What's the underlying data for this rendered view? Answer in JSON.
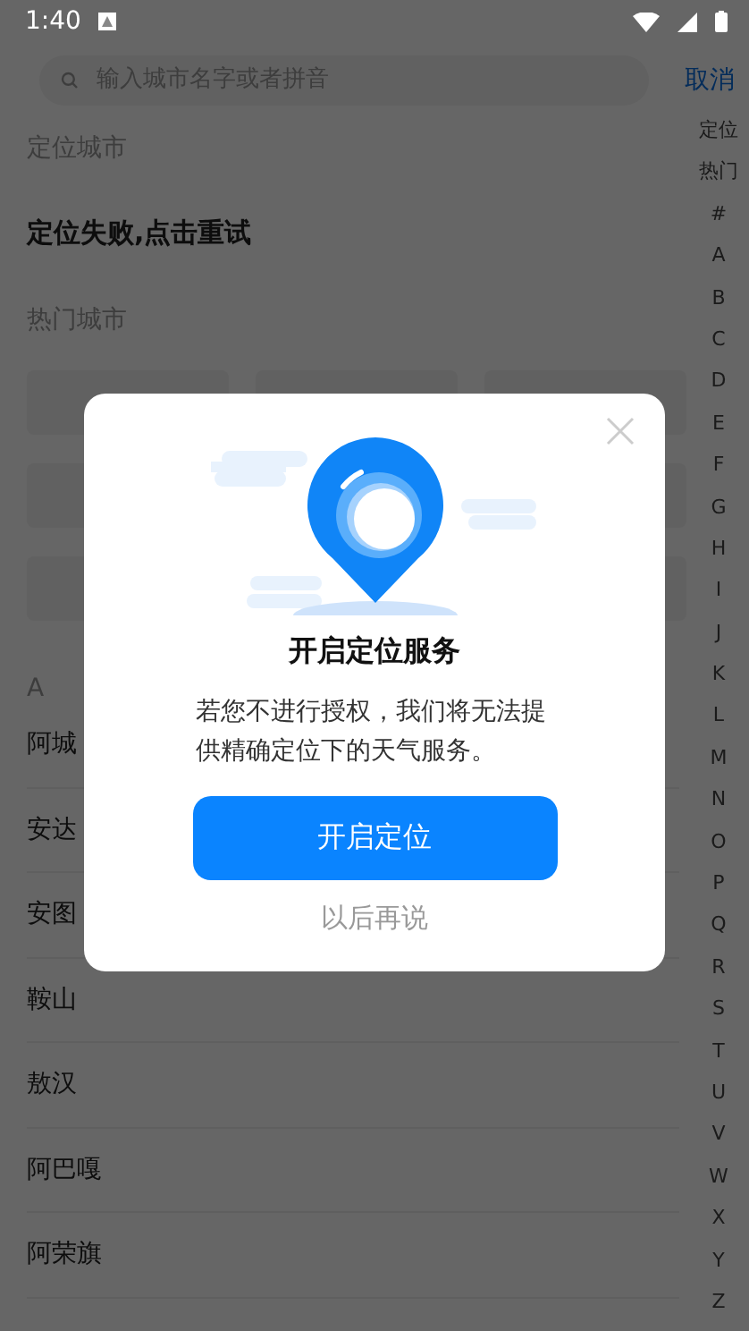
{
  "status_bar": {
    "time": "1:40"
  },
  "search": {
    "placeholder": "输入城市名字或者拼音",
    "cancel": "取消"
  },
  "location_section": {
    "title": "定位城市",
    "message": "定位失败,点击重试"
  },
  "hot_section": {
    "title": "热门城市"
  },
  "city_groups": [
    {
      "letter": "A",
      "cities": [
        "阿城",
        "安达",
        "安图",
        "鞍山",
        "敖汉",
        "阿巴嘎",
        "阿荣旗"
      ]
    }
  ],
  "index_bar": [
    "定位",
    "热门",
    "#",
    "A",
    "B",
    "C",
    "D",
    "E",
    "F",
    "G",
    "H",
    "I",
    "J",
    "K",
    "L",
    "M",
    "N",
    "O",
    "P",
    "Q",
    "R",
    "S",
    "T",
    "U",
    "V",
    "W",
    "X",
    "Y",
    "Z"
  ],
  "dialog": {
    "title": "开启定位服务",
    "message": "若您不进行授权，我们将无法提供精确定位下的天气服务。",
    "confirm": "开启定位",
    "later": "以后再说"
  }
}
